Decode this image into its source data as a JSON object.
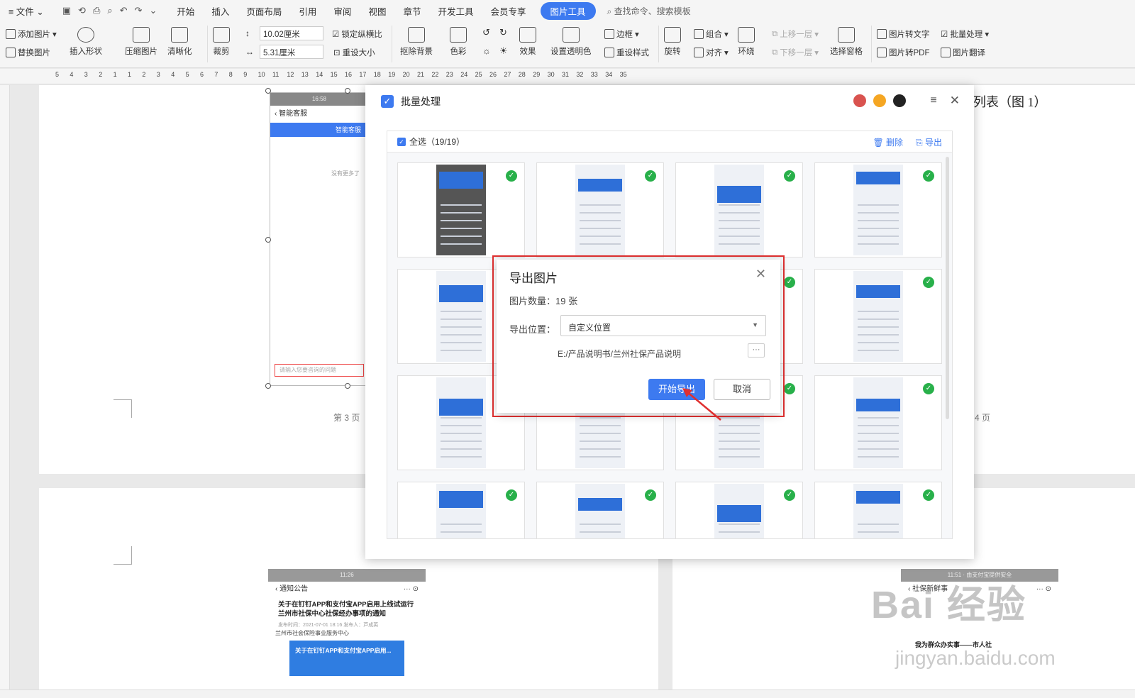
{
  "menubar": {
    "file_label": "文件",
    "tabs": [
      "开始",
      "插入",
      "页面布局",
      "引用",
      "审阅",
      "视图",
      "章节",
      "开发工具",
      "会员专享"
    ],
    "active_tab": "图片工具",
    "search_placeholder": "查找命令、搜索模板"
  },
  "ribbon": {
    "add_picture": "添加图片",
    "replace_picture": "替换图片",
    "insert_shape": "插入形状",
    "compress": "压缩图片",
    "sharpen": "清晰化",
    "crop": "裁剪",
    "width_value": "10.02厘米",
    "height_value": "5.31厘米",
    "lock_ratio": "锁定纵横比",
    "reset_size": "重设大小",
    "remove_bg": "抠除背景",
    "color": "色彩",
    "effects": "效果",
    "transparent": "设置透明色",
    "border": "边框",
    "reset_style": "重设样式",
    "rotate": "旋转",
    "group": "组合",
    "align": "对齐",
    "wrap": "环绕",
    "bring_forward": "上移一层",
    "send_backward": "下移一层",
    "selection_pane": "选择窗格",
    "pic_to_text": "图片转文字",
    "pic_to_pdf": "图片转PDF",
    "batch": "批量处理",
    "translate": "图片翻译"
  },
  "ruler_numbers": [
    "5",
    "4",
    "3",
    "2",
    "1",
    "1",
    "2",
    "3",
    "4",
    "5",
    "6",
    "7",
    "8",
    "9",
    "10",
    "11",
    "12",
    "13",
    "14",
    "15",
    "16",
    "17",
    "18",
    "19",
    "20",
    "21",
    "22",
    "23",
    "24",
    "25",
    "26",
    "27",
    "28",
    "29",
    "30",
    "31",
    "32",
    "33",
    "34",
    "35"
  ],
  "document": {
    "heading_fragment": "列表（图 1）",
    "page3_label": "第 3 页",
    "page4_label": "4 页",
    "phone1_header": "智能客服",
    "phone1_bar": "智能客服",
    "phone1_time": "16:58",
    "phone1_empty": "没有更多了",
    "phone1_input": "请输入您要咨询的问题",
    "phone2_time": "11:26",
    "phone2_header": "通知公告",
    "phone2_headline": "关于在钉钉APP和支付宝APP启用上线试运行兰州市社保中心社保经办事项的通知",
    "phone2_meta": "发布时间：2021-07-01 18:16    发布人：芦成英",
    "phone2_org": "兰州市社会保险事业服务中心",
    "phone2_banner": "关于在钉钉APP和支付宝APP启用...",
    "phone3_time": "11:51",
    "phone3_status": "由支付宝提供安全",
    "phone3_header": "社保新鲜事",
    "phone3_line": "我为群众办实事——市人社",
    "watermark": "Bai 经验",
    "watermark_url": "jingyan.baidu.com"
  },
  "batch_dialog": {
    "title": "批量处理",
    "select_all": "全选（19/19）",
    "delete_label": "删除",
    "export_label": "导出",
    "thumb_count_visible": 16
  },
  "export_dialog": {
    "title": "导出图片",
    "count_label": "图片数量：",
    "count_value": "19 张",
    "location_label": "导出位置：",
    "location_value": "自定义位置",
    "path": "E:/产品说明书/兰州社保产品说明",
    "browse": "···",
    "start_button": "开始导出",
    "cancel_button": "取消"
  },
  "colors": {
    "accent": "#3d7af0",
    "check_green": "#28b04a",
    "highlight_red": "#e03030"
  }
}
